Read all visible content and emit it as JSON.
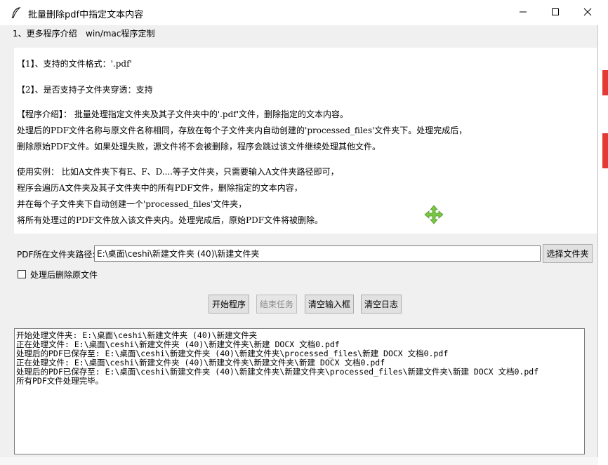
{
  "window": {
    "title": "批量删除pdf中指定文本内容"
  },
  "menu": {
    "items": [
      "1、更多程序介绍",
      "win/mac程序定制"
    ]
  },
  "info": {
    "lines": [
      "【1】、支持的文件格式：'.pdf'",
      "【2】、是否支持子文件夹穿透：支持",
      "【程序介绍】： 批量处理指定文件夹及其子文件夹中的'.pdf'文件，删除指定的文本内容。",
      "处理后的PDF文件名称与原文件名称相同，存放在每个子文件夹内自动创建的'processed_files'文件夹下。处理完成后，",
      "删除原始PDF文件。如果处理失败，源文件将不会被删除，程序会跳过该文件继续处理其他文件。",
      "使用实例： 比如A文件夹下有E、F、D....等子文件夹，只需要输入A文件夹路径即可，",
      "程序会遍历A文件夹及其子文件夹中的所有PDF文件，删除指定的文本内容，",
      "并在每个子文件夹下自动创建一个'processed_files'文件夹，",
      "将所有处理过的PDF文件放入该文件夹内。处理完成后，原始PDF文件将被删除。"
    ]
  },
  "form": {
    "path_label": "PDF所在文件夹路径:",
    "path_value": "E:\\桌面\\ceshi\\新建文件夹 (40)\\新建文件夹",
    "choose_folder_label": "选择文件夹",
    "delete_original_label": "处理后删除原文件",
    "delete_original_checked": false
  },
  "actions": {
    "start_label": "开始程序",
    "end_label": "结束任务",
    "clear_input_label": "清空输入框",
    "clear_log_label": "清空日志"
  },
  "log": {
    "lines": [
      "开始处理文件夹: E:\\桌面\\ceshi\\新建文件夹 (40)\\新建文件夹",
      "正在处理文件: E:\\桌面\\ceshi\\新建文件夹 (40)\\新建文件夹\\新建 DOCX 文档0.pdf",
      "处理后的PDF已保存至: E:\\桌面\\ceshi\\新建文件夹 (40)\\新建文件夹\\processed_files\\新建 DOCX 文档0.pdf",
      "正在处理文件: E:\\桌面\\ceshi\\新建文件夹 (40)\\新建文件夹\\新建文件夹\\新建 DOCX 文档0.pdf",
      "处理后的PDF已保存至: E:\\桌面\\ceshi\\新建文件夹 (40)\\新建文件夹\\新建文件夹\\processed_files\\新建文件夹\\新建 DOCX 文档0.pdf",
      "所有PDF文件处理完毕。"
    ]
  },
  "colors": {
    "move_cursor": "#7ac943",
    "background_mark": "#e53935"
  }
}
